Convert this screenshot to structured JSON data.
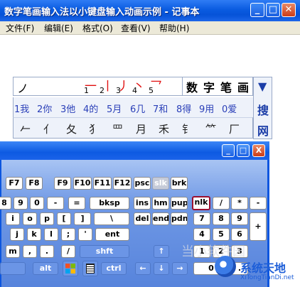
{
  "notepad": {
    "title": "数字笔画输入法以小键盘输入动画示例 - 记事本",
    "menu": [
      "文件(F)",
      "编辑(E)",
      "格式(O)",
      "查看(V)",
      "帮助(H)"
    ]
  },
  "ime": {
    "input_stroke": "ノ",
    "strokes": [
      {
        "glyph": "一",
        "num": "1"
      },
      {
        "glyph": "丨",
        "num": "2"
      },
      {
        "glyph": "丿",
        "num": "3"
      },
      {
        "glyph": "丶",
        "num": "4"
      },
      {
        "glyph": "乛",
        "num": "5"
      }
    ],
    "name_chars": [
      "数",
      "字",
      "笔",
      "画"
    ],
    "candidates": [
      "1我",
      "2你",
      "3他",
      "4的",
      "5月",
      "6几",
      "7和",
      "8得",
      "9用",
      "0爱"
    ],
    "radicals": [
      "𠂉",
      "亻",
      "夂",
      "犭",
      "罒",
      "月",
      "禾",
      "钅",
      "⺮",
      "厂"
    ],
    "side": {
      "arrow": "▼",
      "chars": [
        "搜",
        "网"
      ]
    }
  },
  "keyboard": {
    "window_buttons": [
      "_",
      "□",
      "X"
    ],
    "rows": [
      [
        "F7",
        "F8",
        "F9",
        "F10",
        "F11",
        "F12",
        "psc",
        "slk",
        "brk"
      ],
      [
        "8",
        "9",
        "0",
        "-",
        "=",
        "bksp",
        "ins",
        "hm",
        "pup",
        "nlk",
        "/",
        "*",
        "-"
      ],
      [
        "i",
        "o",
        "p",
        "[",
        "]",
        "\\",
        "del",
        "end",
        "pdn",
        "7",
        "8",
        "9"
      ],
      [
        "j",
        "k",
        "l",
        ";",
        "'",
        "ent",
        "4",
        "5",
        "6",
        "+"
      ],
      [
        "m",
        ",",
        ".",
        "/",
        "shft",
        "↑",
        "1",
        "2",
        "3"
      ],
      [
        "alt",
        "ctrl",
        "←",
        "↓",
        "→",
        "0",
        "."
      ]
    ]
  },
  "watermark": {
    "text": "系统天地",
    "url": "XiTongTianDi.net",
    "faint": "当小软件园"
  },
  "colors": {
    "titlebar": "#0653d8",
    "stroke_red": "#e01010",
    "candidate_blue": "#2a3fb8",
    "nlk_border": "#9b1030"
  }
}
